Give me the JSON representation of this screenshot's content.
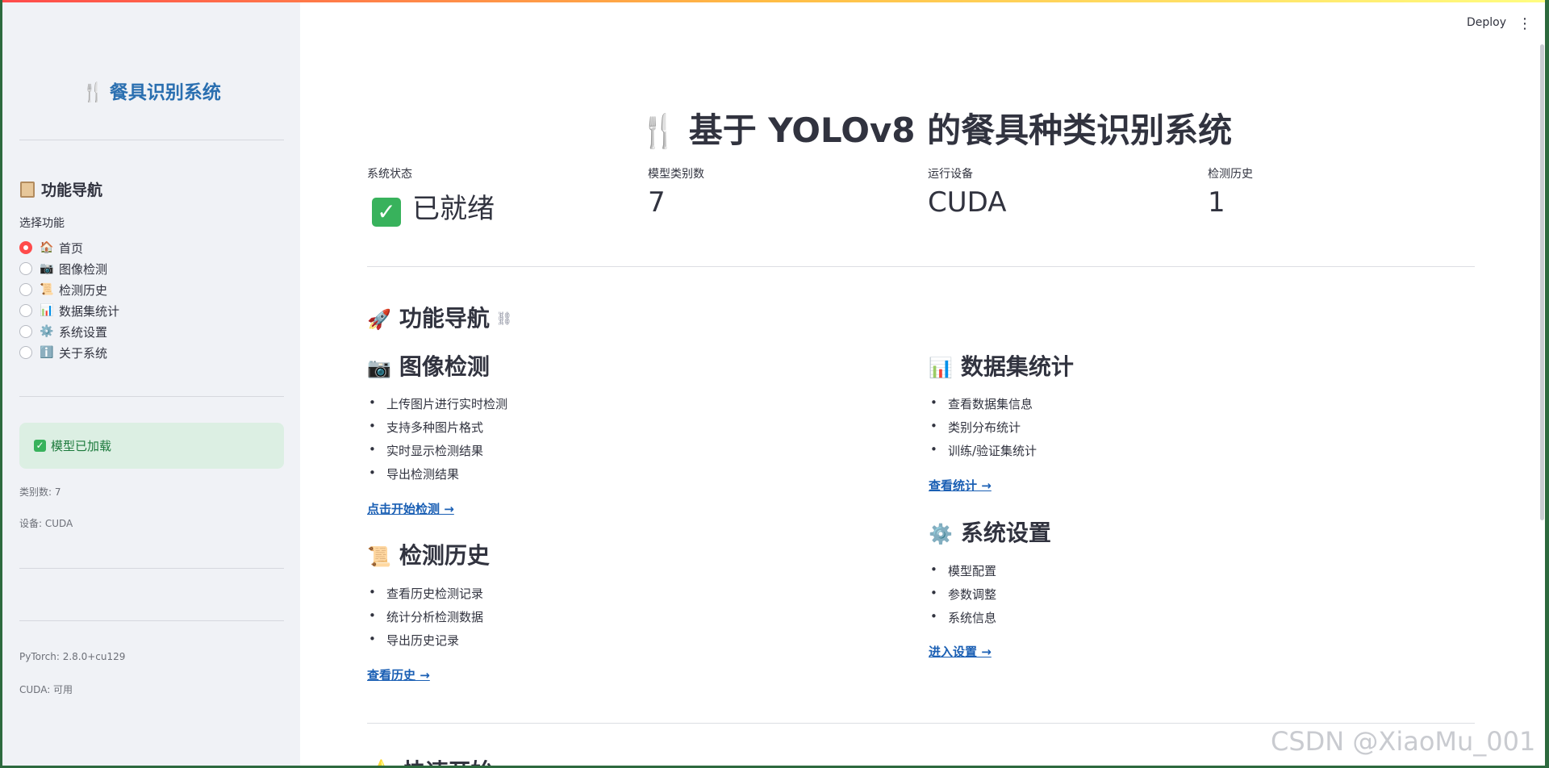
{
  "sidebar": {
    "title": "餐具识别系统",
    "nav_heading": "功能导航",
    "select_label": "选择功能",
    "options": [
      {
        "emoji": "🏠",
        "label": "首页",
        "selected": true
      },
      {
        "emoji": "📷",
        "label": "图像检测",
        "selected": false
      },
      {
        "emoji": "📜",
        "label": "检测历史",
        "selected": false
      },
      {
        "emoji": "📊",
        "label": "数据集统计",
        "selected": false
      },
      {
        "emoji": "⚙️",
        "label": "系统设置",
        "selected": false
      },
      {
        "emoji": "ℹ️",
        "label": "关于系统",
        "selected": false
      }
    ],
    "model_loaded": "模型已加载",
    "class_count": "类别数: 7",
    "device": "设备: CUDA",
    "pytorch": "PyTorch: 2.8.0+cu129",
    "cuda": "CUDA: 可用"
  },
  "toolbar": {
    "deploy": "Deploy"
  },
  "main": {
    "title": "基于 YOLOv8 的餐具种类识别系统",
    "metrics": [
      {
        "label": "系统状态",
        "value": "已就绪"
      },
      {
        "label": "模型类别数",
        "value": "7"
      },
      {
        "label": "运行设备",
        "value": "CUDA"
      },
      {
        "label": "检测历史",
        "value": "1"
      }
    ],
    "nav_heading": "功能导航",
    "sections": {
      "detect": {
        "title": "图像检测",
        "items": [
          "上传图片进行实时检测",
          "支持多种图片格式",
          "实时显示检测结果",
          "导出检测结果"
        ],
        "link": "点击开始检测 →"
      },
      "history": {
        "title": "检测历史",
        "items": [
          "查看历史检测记录",
          "统计分析检测数据",
          "导出历史记录"
        ],
        "link": "查看历史 →"
      },
      "stats": {
        "title": "数据集统计",
        "items": [
          "查看数据集信息",
          "类别分布统计",
          "训练/验证集统计"
        ],
        "link": "查看统计 →"
      },
      "settings": {
        "title": "系统设置",
        "items": [
          "模型配置",
          "参数调整",
          "系统信息"
        ],
        "link": "进入设置 →"
      }
    },
    "cut_heading": "快速开始"
  },
  "watermark": "CSDN @XiaoMu_001"
}
